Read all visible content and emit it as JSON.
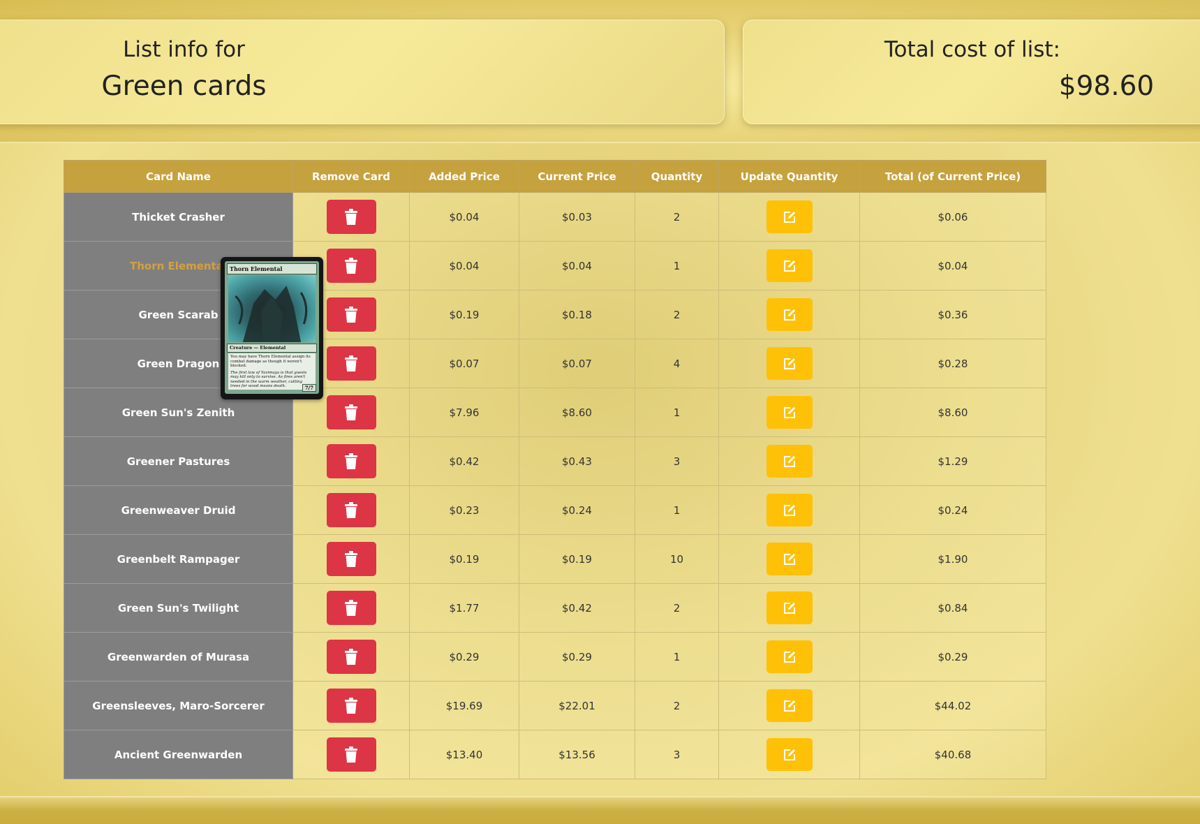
{
  "header": {
    "list_info_label": "List info for",
    "list_name": "Green cards",
    "total_label": "Total cost of list:",
    "total_value": "$98.60"
  },
  "table": {
    "columns": [
      "Card Name",
      "Remove Card",
      "Added Price",
      "Current Price",
      "Quantity",
      "Update Quantity",
      "Total (of Current Price)"
    ],
    "rows": [
      {
        "name": "Thicket Crasher",
        "added": "$0.04",
        "current": "$0.03",
        "qty": "2",
        "total": "$0.06"
      },
      {
        "name": "Thorn Elemental",
        "added": "$0.04",
        "current": "$0.04",
        "qty": "1",
        "total": "$0.04"
      },
      {
        "name": "Green Scarab",
        "added": "$0.19",
        "current": "$0.18",
        "qty": "2",
        "total": "$0.36"
      },
      {
        "name": "Green Dragon",
        "added": "$0.07",
        "current": "$0.07",
        "qty": "4",
        "total": "$0.28"
      },
      {
        "name": "Green Sun's Zenith",
        "added": "$7.96",
        "current": "$8.60",
        "qty": "1",
        "total": "$8.60"
      },
      {
        "name": "Greener Pastures",
        "added": "$0.42",
        "current": "$0.43",
        "qty": "3",
        "total": "$1.29"
      },
      {
        "name": "Greenweaver Druid",
        "added": "$0.23",
        "current": "$0.24",
        "qty": "1",
        "total": "$0.24"
      },
      {
        "name": "Greenbelt Rampager",
        "added": "$0.19",
        "current": "$0.19",
        "qty": "10",
        "total": "$1.90"
      },
      {
        "name": "Green Sun's Twilight",
        "added": "$1.77",
        "current": "$0.42",
        "qty": "2",
        "total": "$0.84"
      },
      {
        "name": "Greenwarden of Murasa",
        "added": "$0.29",
        "current": "$0.29",
        "qty": "1",
        "total": "$0.29"
      },
      {
        "name": "Greensleeves, Maro-Sorcerer",
        "added": "$19.69",
        "current": "$22.01",
        "qty": "2",
        "total": "$44.02"
      },
      {
        "name": "Ancient Greenwarden",
        "added": "$13.40",
        "current": "$13.56",
        "qty": "3",
        "total": "$40.68"
      }
    ]
  },
  "hovered_row": 1,
  "card_preview": {
    "title": "Thorn Elemental",
    "type_line": "Creature — Elemental",
    "rules_text": "You may have Thorn Elemental assign its combat damage as though it weren't blocked.",
    "flavor_text": "The first law of Yavimaya is that guests may kill only to survive. As fires aren't needed in the warm weather, cutting trees for wood means death.",
    "power_toughness": "7/7"
  },
  "colors": {
    "header_bg": "#c5a23e",
    "name_cell_bg": "#7f7f80",
    "remove_button": "#dc3545",
    "update_button": "#ffc107",
    "hover_text": "#d3a13e"
  },
  "icons": {
    "remove": "trash-icon",
    "update": "edit-icon"
  }
}
